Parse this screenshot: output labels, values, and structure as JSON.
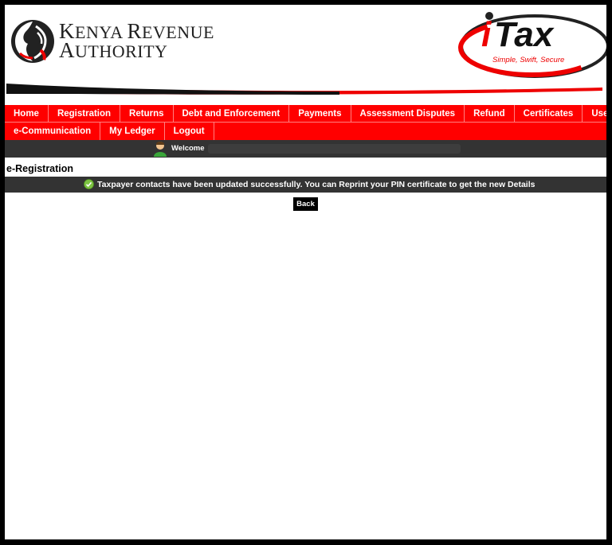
{
  "header": {
    "org_name_line1": "KENYA REVENUE",
    "org_name_line2": "AUTHORITY",
    "itax_brand": "iTax",
    "itax_tagline": "Simple, Swift, Secure"
  },
  "nav": {
    "row1": [
      "Home",
      "Registration",
      "Returns",
      "Debt and Enforcement",
      "Payments",
      "Assessment Disputes",
      "Refund",
      "Certificates",
      "Useful Links"
    ],
    "row2": [
      "e-Communication",
      "My Ledger",
      "Logout"
    ]
  },
  "welcome": {
    "label": "Welcome"
  },
  "page": {
    "heading": "e-Registration",
    "success_message": "Taxpayer contacts have been updated successfully. You can Reprint your PIN certificate to get the new Details",
    "back_label": "Back"
  },
  "colors": {
    "nav_bg": "#ff0000",
    "bar_bg": "#333333",
    "success_green": "#7cc242"
  }
}
